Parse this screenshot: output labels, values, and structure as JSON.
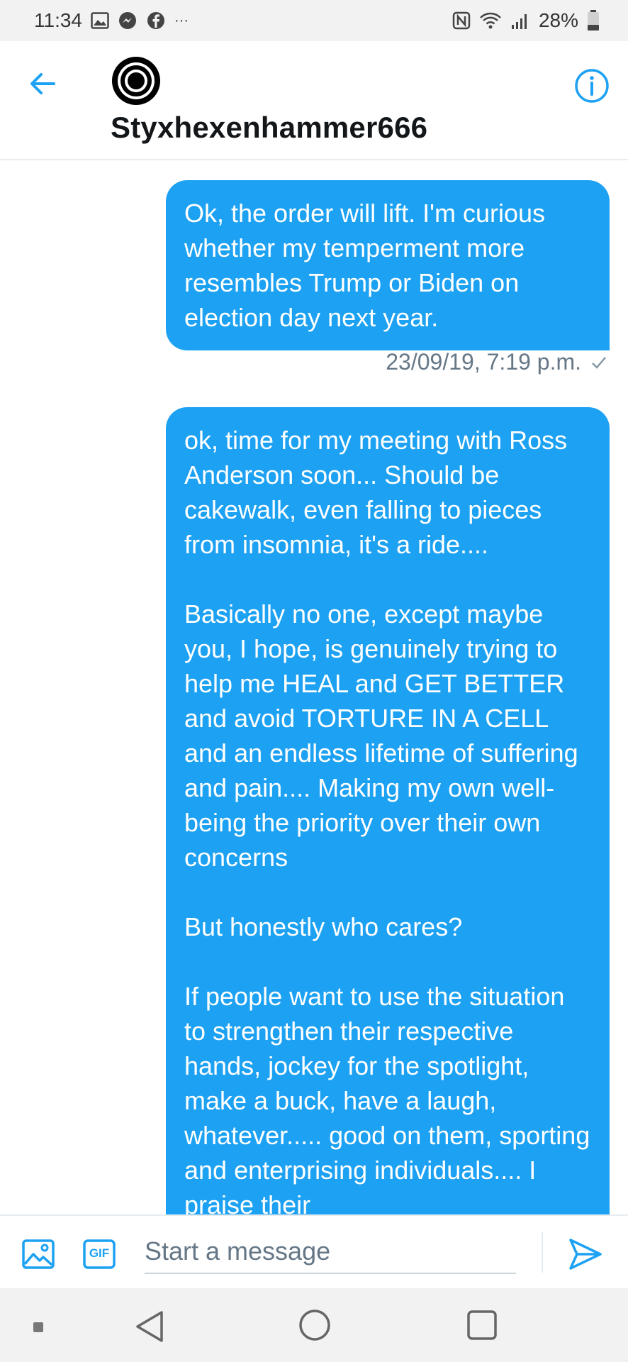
{
  "status_bar": {
    "time": "11:34",
    "more": "···",
    "battery": "28%",
    "icons": [
      "gallery-icon",
      "messenger-icon",
      "facebook-icon",
      "nfc-icon",
      "wifi-icon",
      "signal-icon",
      "battery-icon"
    ]
  },
  "header": {
    "contact_name": "Styxhexenhammer666",
    "back_icon": "back-arrow-icon",
    "info_icon": "info-icon"
  },
  "messages": [
    {
      "text": "Ok, the order will lift. I'm curious whether my temperment more resembles Trump or Biden on election day next year.",
      "timestamp": "23/09/19, 7:19 p.m.",
      "status_icon": "check-icon"
    },
    {
      "text": "ok, time for my meeting with Ross Anderson soon... Should be cakewalk, even falling to pieces from insomnia, it's a ride....\n\nBasically no one, except maybe you, I hope, is genuinely trying to help me HEAL and GET BETTER and avoid TORTURE IN A CELL and an endless lifetime of suffering and pain.... Making my own well-being the priority over their own concerns\n\nBut honestly who cares?\n\nIf people want to use the situation to strengthen their respective hands, jockey for the spotlight, make a buck, have a laugh, whatever..... good on them, sporting and enterprising individuals.... I praise their"
    }
  ],
  "composer": {
    "placeholder": "Start a message",
    "gif_label": "GIF",
    "media_icon": "image-icon",
    "send_icon": "send-icon"
  },
  "colors": {
    "accent": "#1da1f2",
    "bubble_text": "#ffffff",
    "muted": "#657786"
  }
}
